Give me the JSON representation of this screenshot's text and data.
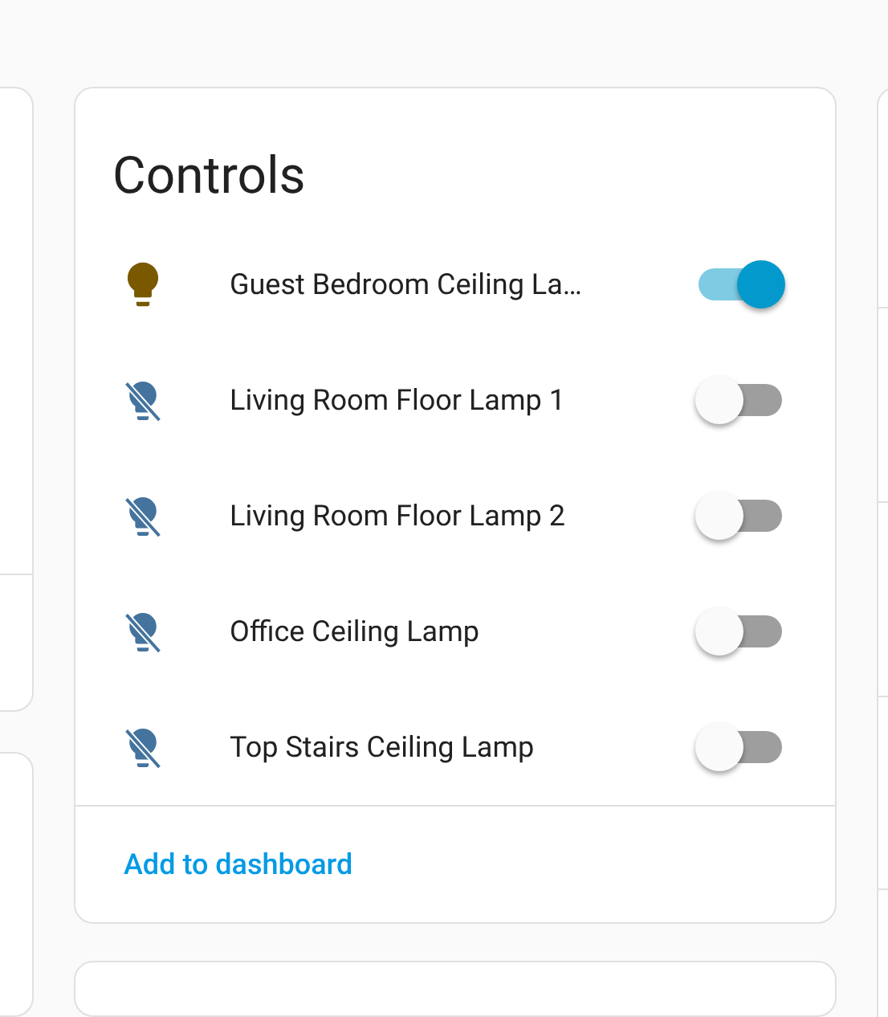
{
  "card": {
    "title": "Controls",
    "entities": [
      {
        "name": "Guest Bedroom Ceiling La…",
        "on": true
      },
      {
        "name": "Living Room Floor Lamp 1",
        "on": false
      },
      {
        "name": "Living Room Floor Lamp 2",
        "on": false
      },
      {
        "name": "Office Ceiling Lamp",
        "on": false
      },
      {
        "name": "Top Stairs Ceiling Lamp",
        "on": false
      }
    ],
    "action": "Add to dashboard"
  }
}
